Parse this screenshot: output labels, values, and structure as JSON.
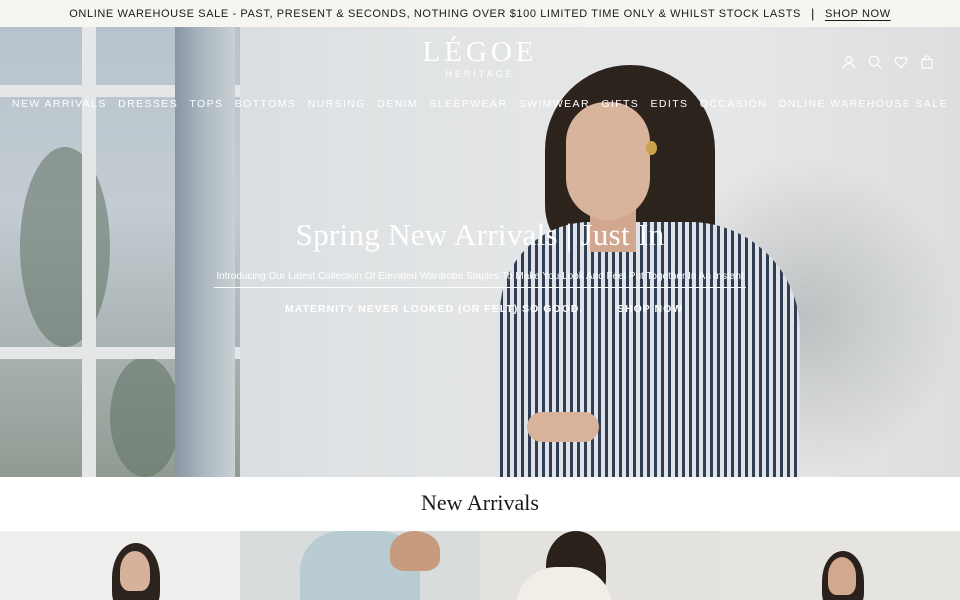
{
  "announcement": {
    "text": "ONLINE WAREHOUSE SALE - PAST, PRESENT & SECONDS, NOTHING OVER $100 LIMITED TIME ONLY & WHILST STOCK LASTS",
    "separator": "|",
    "link": "SHOP NOW"
  },
  "brand": {
    "name": "LÉGOE",
    "tagline": "HERITAGE"
  },
  "header_icons": [
    "account-icon",
    "search-icon",
    "wishlist-heart-icon",
    "shopping-bag-icon"
  ],
  "nav": [
    "NEW ARRIVALS",
    "DRESSES",
    "TOPS",
    "BOTTOMS",
    "NURSING",
    "DENIM",
    "SLEEPWEAR",
    "SWIMWEAR",
    "GIFTS",
    "EDITS",
    "OCCASION",
    "ONLINE WAREHOUSE SALE"
  ],
  "hero": {
    "headline": "Spring New Arrivals | Just In",
    "intro": "Introducing Our Latest Collection Of Elevated Wardrobe Staples To Make You Look And Feel Put Together In An Instant",
    "tagline": "MATERNITY NEVER LOOKED (OR FELT) SO GOOD.",
    "cta": "SHOP NOW"
  },
  "section": {
    "title": "New Arrivals"
  },
  "colors": {
    "announce_bg": "#f7f5f2",
    "text_dark": "#1a1a1a",
    "hero_text": "#ffffff"
  }
}
